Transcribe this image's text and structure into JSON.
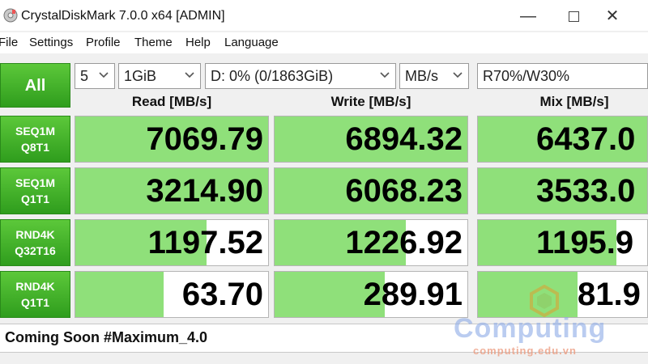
{
  "window": {
    "title": "CrystalDiskMark 7.0.0 x64 [ADMIN]",
    "controls": {
      "minimize": "—",
      "close": "✕"
    }
  },
  "menu": [
    "File",
    "Settings",
    "Profile",
    "Theme",
    "Help",
    "Language"
  ],
  "toolbar": {
    "all_label": "All",
    "count": "5",
    "size": "1GiB",
    "drive": "D: 0% (0/1863GiB)",
    "unit": "MB/s",
    "mix": "R70%/W30%"
  },
  "columns": {
    "read": "Read [MB/s]",
    "write": "Write [MB/s]",
    "mix": "Mix [MB/s]"
  },
  "tests": [
    {
      "line1": "SEQ1M",
      "line2": "Q8T1",
      "read": "7069.79",
      "write": "6894.32",
      "mix": "6437.0",
      "read_fill": 1.0,
      "write_fill": 1.0,
      "mix_fill": 1.0
    },
    {
      "line1": "SEQ1M",
      "line2": "Q1T1",
      "read": "3214.90",
      "write": "6068.23",
      "mix": "3533.0",
      "read_fill": 1.0,
      "write_fill": 1.0,
      "mix_fill": 1.0
    },
    {
      "line1": "RND4K",
      "line2": "Q32T16",
      "read": "1197.52",
      "write": "1226.92",
      "mix": "1195.9",
      "read_fill": 0.68,
      "write_fill": 0.68,
      "mix_fill": 0.82
    },
    {
      "line1": "RND4K",
      "line2": "Q1T1",
      "read": "63.70",
      "write": "289.91",
      "mix": "81.9",
      "read_fill": 0.46,
      "write_fill": 0.57,
      "mix_fill": 0.59
    }
  ],
  "comment": "Coming Soon #Maximum_4.0",
  "watermark": {
    "title": "Computing",
    "url": "computing.edu.vn"
  },
  "colors": {
    "green_dark": "#2f9d1d",
    "green_light": "#5cc83a",
    "bar_fill": "#8fe07a"
  }
}
